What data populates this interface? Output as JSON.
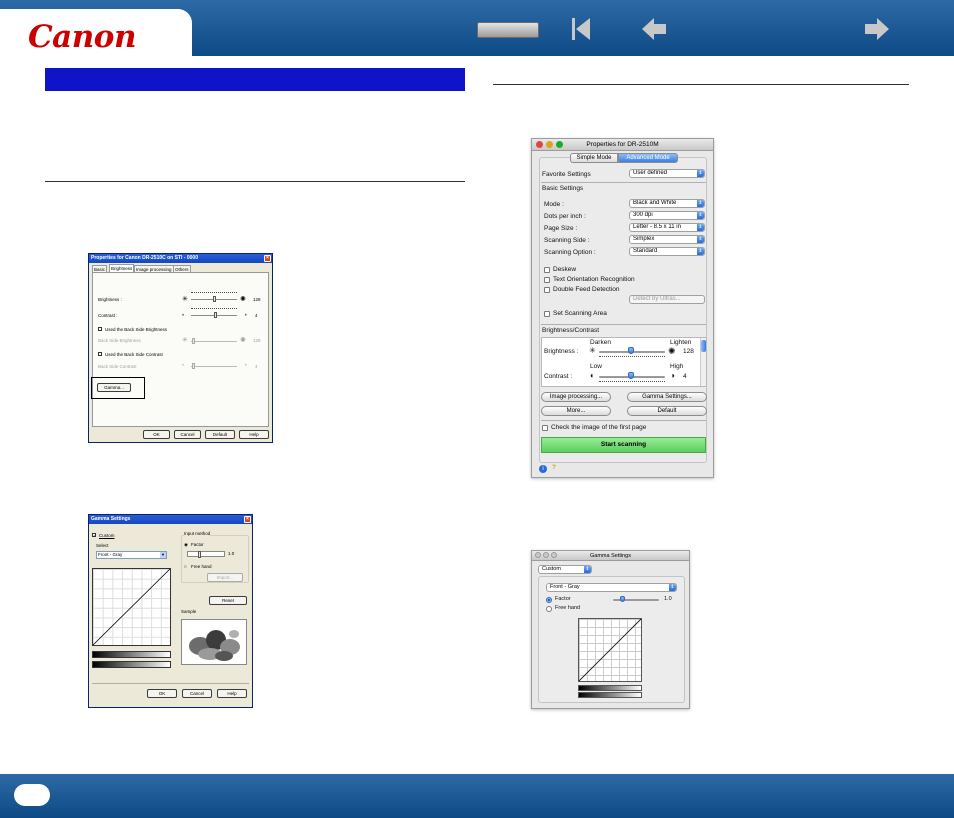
{
  "header": {
    "logo_text": "Canon",
    "logo_color": "#cc0000",
    "toc_button_label": "",
    "first_page_icon": "first-page-icon",
    "prev_page_icon": "prev-page-icon",
    "next_page_icon": "next-page-icon",
    "bar_color": "#1a5b9b"
  },
  "footer": {
    "page_number": ""
  },
  "windows_props": {
    "title": "Properties for Canon DR-2510C on STI - 0000",
    "tabs": [
      "Basic",
      "Brightness",
      "Image processing",
      "Others"
    ],
    "brightness_label": "Brightness :",
    "brightness_value": "128",
    "contrast_label": "Contrast :",
    "contrast_value": "4",
    "use_back_brightness": "Used the Back Side Brightness",
    "back_brightness_label": "Back Side Brightness",
    "back_brightness_value": "128",
    "use_back_contrast": "Used the Back Side Contrast",
    "back_contrast_label": "Back Side Contrast",
    "back_contrast_value": "4",
    "gamma_button": "Gamma...",
    "ok": "OK",
    "cancel": "Cancel",
    "default": "Default",
    "help": "Help"
  },
  "windows_gamma": {
    "title": "Gamma Settings",
    "custom_label": "Custom",
    "select_label": "Select",
    "select_value": "Front - Gray",
    "input_method_label": "Input method",
    "factor_label": "Factor",
    "factor_value": "1.0",
    "free_hand_label": "Free hand",
    "import_button": "Import...",
    "reset_button": "Reset",
    "sample_label": "Sample",
    "ok": "OK",
    "cancel": "Cancel",
    "help": "Help"
  },
  "mac_props": {
    "title": "Properties for DR-2510M",
    "mode_tabs": [
      "Simple Mode",
      "Advanced Mode"
    ],
    "favorite_label": "Favorite Settings",
    "favorite_value": "User defined",
    "basic_settings_label": "Basic Settings",
    "mode_label": "Mode :",
    "mode_value": "Black and White",
    "dpi_label": "Dots per inch :",
    "dpi_value": "300 dpi",
    "page_size_label": "Page Size :",
    "page_size_value": "Letter - 8.5 x 11 in",
    "scanning_side_label": "Scanning Side :",
    "scanning_side_value": "Simplex",
    "scanning_option_label": "Scanning Option :",
    "scanning_option_value": "Standard",
    "deskew": "Deskew",
    "text_orientation": "Text Orientation Recognition",
    "double_feed": "Double Feed Detection",
    "detect_by": "Detect by Ultras...",
    "set_scanning_area": "Set Scanning Area",
    "brightness_contrast_label": "Brightness/Contrast",
    "darken": "Darken",
    "lighten": "Lighten",
    "brightness_label": "Brightness :",
    "brightness_value": "128",
    "low": "Low",
    "high": "High",
    "contrast_label": "Contrast :",
    "contrast_value": "4",
    "image_processing_button": "Image processing...",
    "gamma_settings_button": "Gamma Settings...",
    "more_button": "More...",
    "default_button": "Default",
    "check_first_page": "Check the image of the first page",
    "start_scanning": "Start scanning",
    "start_color": "#6fd96f"
  },
  "mac_gamma": {
    "title": "Gamma Settings",
    "preset_value": "Custom",
    "channel_value": "Front - Gray",
    "factor_label": "Factor",
    "factor_value": "1.0",
    "free_hand_label": "Free hand"
  }
}
